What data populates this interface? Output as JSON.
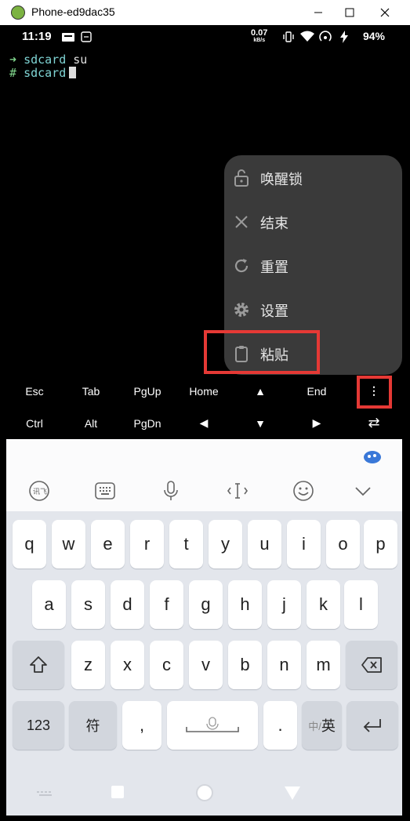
{
  "window": {
    "title": "Phone-ed9dac35"
  },
  "status_bar": {
    "time": "11:19",
    "net_speed_value": "0.07",
    "net_speed_unit": "kB/s",
    "battery": "94%"
  },
  "terminal": {
    "lines": [
      {
        "prefix": "➜",
        "dir": "sdcard",
        "cmd": "su"
      },
      {
        "prefix": "#",
        "dir": "sdcard",
        "cmd": ""
      }
    ]
  },
  "menu": {
    "items": [
      {
        "label": "唤醒锁",
        "icon": "lock-open-icon"
      },
      {
        "label": "结束",
        "icon": "close-icon"
      },
      {
        "label": "重置",
        "icon": "refresh-icon"
      },
      {
        "label": "设置",
        "icon": "gear-icon"
      },
      {
        "label": "粘贴",
        "icon": "clipboard-icon"
      }
    ]
  },
  "extra_keys": {
    "row1": [
      "Esc",
      "Tab",
      "PgUp",
      "Home",
      "▲",
      "End",
      "⋮"
    ],
    "row2": [
      "Ctrl",
      "Alt",
      "PgDn",
      "◀",
      "▼",
      "▶",
      "⇄"
    ]
  },
  "keyboard": {
    "toolbar": [
      "handwriting-icon",
      "keyboard-icon",
      "mic-icon",
      "cursor-icon",
      "emoji-icon",
      "chevron-down-icon"
    ],
    "row1": [
      "q",
      "w",
      "e",
      "r",
      "t",
      "y",
      "u",
      "i",
      "o",
      "p"
    ],
    "row2": [
      "a",
      "s",
      "d",
      "f",
      "g",
      "h",
      "j",
      "k",
      "l"
    ],
    "row3": [
      "z",
      "x",
      "c",
      "v",
      "b",
      "n",
      "m"
    ],
    "row4": {
      "num": "123",
      "sym": "符",
      "comma": ",",
      "period": ".",
      "lang_cn": "中/",
      "lang_en": "英"
    }
  },
  "colors": {
    "highlight": "#e53935",
    "menu_bg": "#3a3a3a",
    "prompt_green": "#7fd48b",
    "prompt_cyan": "#7fd4d4"
  }
}
